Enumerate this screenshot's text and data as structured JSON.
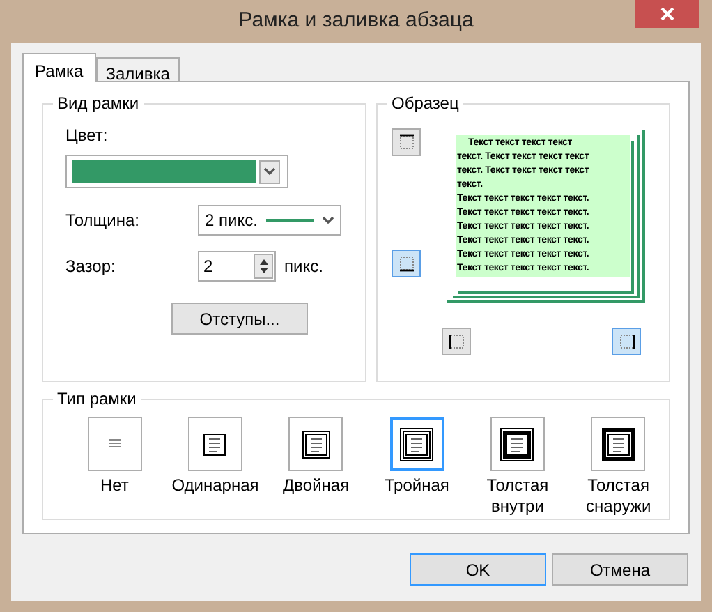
{
  "window": {
    "title": "Рамка и заливка абзаца"
  },
  "tabs": [
    {
      "label": "Рамка",
      "selected": true
    },
    {
      "label": "Заливка",
      "selected": false
    }
  ],
  "border_style": {
    "label": "Вид рамки",
    "color_label": "Цвет:",
    "color": "#339966",
    "thickness_label": "Толщина:",
    "thickness": "2 пикс.",
    "gap_label": "Зазор:",
    "gap": "2",
    "gap_unit": "пикс.",
    "indents_button": "Отступы..."
  },
  "preview": {
    "label": "Образец",
    "text_lines": [
      "Текст текст текст текст",
      "текст. Текст текст текст текст",
      "текст. Текст текст текст текст",
      "текст.",
      "Текст текст текст текст текст.",
      "Текст текст текст текст текст.",
      "Текст текст текст текст текст.",
      "Текст текст текст текст текст.",
      "Текст текст текст текст текст.",
      "Текст текст текст текст текст."
    ],
    "sides": [
      {
        "kind": "top",
        "selected": false
      },
      {
        "kind": "bottom",
        "selected": true
      },
      {
        "kind": "left",
        "selected": false
      },
      {
        "kind": "right",
        "selected": true
      }
    ]
  },
  "frame_type": {
    "label": "Тип рамки",
    "options": [
      {
        "kind": "none",
        "label": "Нет",
        "selected": false
      },
      {
        "kind": "single",
        "label": "Одинарная",
        "selected": false
      },
      {
        "kind": "double",
        "label": "Двойная",
        "selected": false
      },
      {
        "kind": "triple",
        "label": "Тройная",
        "selected": true
      },
      {
        "kind": "thick_inside",
        "label": "Толстая внутри",
        "selected": false
      },
      {
        "kind": "thick_outside",
        "label": "Толстая снаружи",
        "selected": false
      }
    ]
  },
  "buttons": [
    {
      "label": "OK",
      "default": true
    },
    {
      "label": "Отмена",
      "default": false
    }
  ]
}
